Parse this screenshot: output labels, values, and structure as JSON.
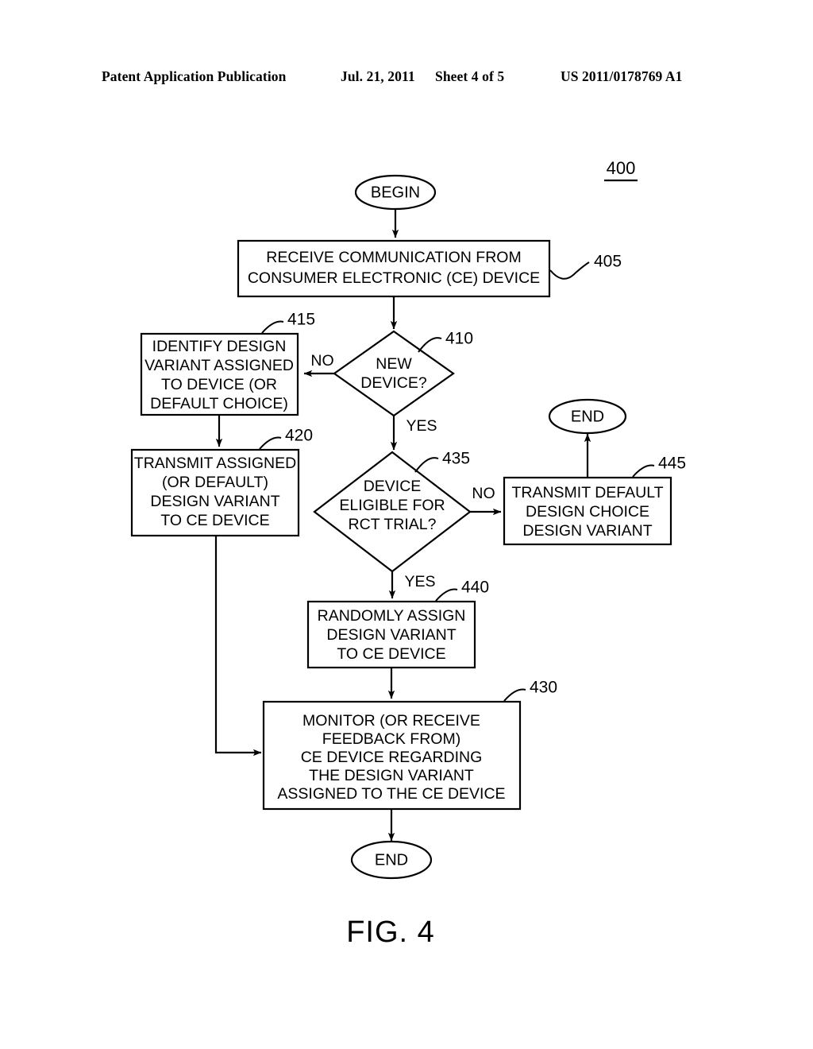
{
  "header": {
    "publication": "Patent Application Publication",
    "date": "Jul. 21, 2011",
    "sheet": "Sheet 4 of 5",
    "publication_number": "US 2011/0178769 A1"
  },
  "figure": {
    "caption": "FIG. 4",
    "flow_id": "400",
    "colors": {
      "ink": "#000000",
      "paper": "#ffffff"
    },
    "terminators": {
      "begin": "BEGIN",
      "end_right": "END",
      "end_bottom": "END"
    },
    "nodes": [
      {
        "ref": "405",
        "kind": "process",
        "lines": [
          "RECEIVE COMMUNICATION FROM",
          "CONSUMER ELECTRONIC (CE) DEVICE"
        ]
      },
      {
        "ref": "410",
        "kind": "decision",
        "lines": [
          "NEW",
          "DEVICE?"
        ]
      },
      {
        "ref": "415",
        "kind": "process",
        "lines": [
          "IDENTIFY DESIGN",
          "VARIANT ASSIGNED",
          "TO DEVICE (OR",
          "DEFAULT CHOICE)"
        ]
      },
      {
        "ref": "420",
        "kind": "process",
        "lines": [
          "TRANSMIT ASSIGNED",
          "(OR DEFAULT)",
          "DESIGN VARIANT",
          "TO CE DEVICE"
        ]
      },
      {
        "ref": "435",
        "kind": "decision",
        "lines": [
          "DEVICE",
          "ELIGIBLE FOR",
          "RCT TRIAL?"
        ]
      },
      {
        "ref": "445",
        "kind": "process",
        "lines": [
          "TRANSMIT DEFAULT",
          "DESIGN CHOICE",
          "DESIGN VARIANT"
        ]
      },
      {
        "ref": "440",
        "kind": "process",
        "lines": [
          "RANDOMLY ASSIGN",
          "DESIGN VARIANT",
          "TO CE DEVICE"
        ]
      },
      {
        "ref": "430",
        "kind": "process",
        "lines": [
          "MONITOR (OR RECEIVE",
          "FEEDBACK FROM)",
          "CE DEVICE REGARDING",
          "THE DESIGN VARIANT",
          "ASSIGNED TO THE CE DEVICE"
        ]
      }
    ],
    "edge_labels": {
      "d410_no": "NO",
      "d410_yes": "YES",
      "d435_no": "NO",
      "d435_yes": "YES"
    }
  }
}
